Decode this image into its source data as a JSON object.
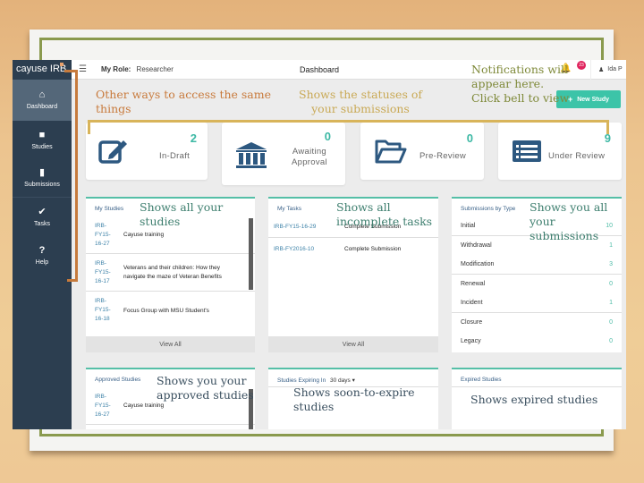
{
  "app": {
    "brand": "cayuse IRB",
    "role_label": "My Role:",
    "role_value": "Researcher",
    "page_title": "Dashboard",
    "notification_count": "23",
    "user_name": "Ida P",
    "new_study_label": "New Study"
  },
  "sidebar": {
    "items": [
      {
        "label": "Dashboard",
        "icon": "home-icon",
        "glyph": "⌂",
        "active": true
      },
      {
        "label": "Studies",
        "icon": "folder-icon",
        "glyph": "■"
      },
      {
        "label": "Submissions",
        "icon": "document-icon",
        "glyph": "▮"
      },
      {
        "label": "Tasks",
        "icon": "checkmark-icon",
        "glyph": "✔"
      },
      {
        "label": "Help",
        "icon": "question-icon",
        "glyph": "?"
      }
    ]
  },
  "stats": [
    {
      "count": "2",
      "label": "In-Draft",
      "icon": "edit-icon"
    },
    {
      "count": "0",
      "label": "Awaiting Approval",
      "label_line1": "Awaiting",
      "label_line2": "Approval",
      "icon": "institution-icon"
    },
    {
      "count": "0",
      "label": "Pre-Review",
      "icon": "folder-open-icon"
    },
    {
      "count": "9",
      "label": "Under Review",
      "icon": "list-icon"
    }
  ],
  "my_studies": {
    "title": "My Studies",
    "rows": [
      {
        "id_lines": [
          "IRB-",
          "FY15-",
          "16-27"
        ],
        "title": "Cayuse training"
      },
      {
        "id_lines": [
          "IRB-",
          "FY15-",
          "16-17"
        ],
        "title": "Veterans and their children: How they navigate the maze of Veteran Benefits"
      },
      {
        "id_lines": [
          "IRB-",
          "FY15-",
          "16-18"
        ],
        "title": "Focus Group with MSU Student's"
      }
    ],
    "view_all": "View All"
  },
  "my_tasks": {
    "title": "My Tasks",
    "rows": [
      {
        "id": "IRB-FY15-16-29",
        "task": "Complete Submission"
      },
      {
        "id": "IRB-FY2016-10",
        "task": "Complete Submission"
      }
    ],
    "view_all": "View All"
  },
  "submissions_by_type": {
    "title": "Submissions by Type",
    "rows": [
      {
        "type": "Initial",
        "count": "10"
      },
      {
        "type": "Withdrawal",
        "count": "1"
      },
      {
        "type": "Modification",
        "count": "3"
      },
      {
        "type": "Renewal",
        "count": "0"
      },
      {
        "type": "Incident",
        "count": "1"
      },
      {
        "type": "Closure",
        "count": "0"
      },
      {
        "type": "Legacy",
        "count": "0"
      }
    ]
  },
  "approved_studies": {
    "title": "Approved Studies",
    "rows": [
      {
        "id_lines": [
          "IRB-",
          "FY15-",
          "16-27"
        ],
        "title": "Cayuse training"
      }
    ]
  },
  "studies_expiring": {
    "title": "Studies Expiring In",
    "selected": "30 days"
  },
  "expired_studies": {
    "title": "Expired Studies"
  },
  "callouts": {
    "other_ways": "Other ways to access the same things",
    "statuses": "Shows the statuses of your submissions",
    "notifications": "Notifications will appear here. Click bell to view",
    "all_studies": "Shows all your studies",
    "incomplete_tasks": "Shows all incomplete tasks",
    "all_submissions": "Shows you all your submissions",
    "approved": "Shows you your approved studies",
    "soon_expire": "Shows soon-to-expire studies",
    "expired": "Shows expired studies"
  }
}
